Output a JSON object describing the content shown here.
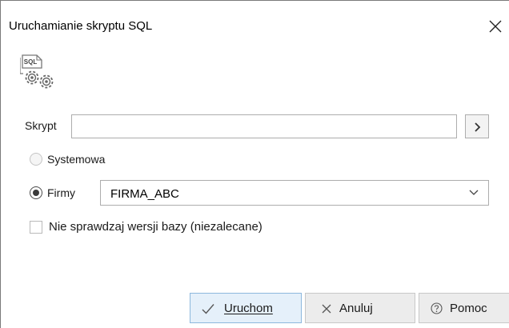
{
  "dialog": {
    "title": "Uruchamianie skryptu SQL",
    "close_icon": "close-icon",
    "header_icon": "sql-script-gears-icon",
    "header_icon_text": "SQL"
  },
  "script": {
    "label": "Skrypt",
    "value": "",
    "browse_icon": "chevron-right-icon"
  },
  "database": {
    "system_label": "Systemowa",
    "system_checked": false,
    "company_label": "Firmy",
    "company_checked": true,
    "company_selected": "FIRMA_ABC"
  },
  "skip_version_check": {
    "label": "Nie sprawdzaj wersji bazy (niezalecane)",
    "checked": false
  },
  "buttons": {
    "run_label": "Uruchom",
    "cancel_label": "Anuluj",
    "help_label": "Pomoc"
  },
  "colors": {
    "primary_button_bg": "#e5f0fa",
    "primary_button_border": "#8db8dd",
    "button_bg": "#ececec"
  }
}
